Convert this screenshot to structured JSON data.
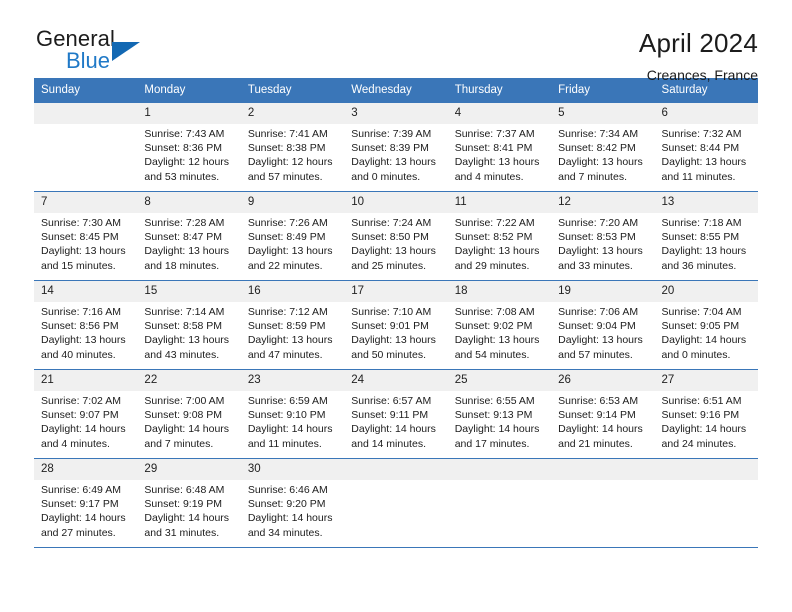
{
  "brand": {
    "name_top": "General",
    "name_bottom": "Blue",
    "accent_color": "#1268b3",
    "text_color": "#1c1c1c"
  },
  "header": {
    "title": "April 2024",
    "subtitle": "Creances, France"
  },
  "theme": {
    "header_row_bg": "#3a76b8",
    "header_row_text": "#ffffff",
    "daynum_bg": "#f0f0f0",
    "row_border": "#3a76b8"
  },
  "weekday_headers": [
    "Sunday",
    "Monday",
    "Tuesday",
    "Wednesday",
    "Thursday",
    "Friday",
    "Saturday"
  ],
  "labels": {
    "sunrise_prefix": "Sunrise:",
    "sunset_prefix": "Sunset:",
    "daylight_prefix": "Daylight:"
  },
  "weeks": [
    [
      {
        "day": "",
        "sunrise": "",
        "sunset": "",
        "daylight": ""
      },
      {
        "day": "1",
        "sunrise": "Sunrise: 7:43 AM",
        "sunset": "Sunset: 8:36 PM",
        "daylight": "Daylight: 12 hours and 53 minutes."
      },
      {
        "day": "2",
        "sunrise": "Sunrise: 7:41 AM",
        "sunset": "Sunset: 8:38 PM",
        "daylight": "Daylight: 12 hours and 57 minutes."
      },
      {
        "day": "3",
        "sunrise": "Sunrise: 7:39 AM",
        "sunset": "Sunset: 8:39 PM",
        "daylight": "Daylight: 13 hours and 0 minutes."
      },
      {
        "day": "4",
        "sunrise": "Sunrise: 7:37 AM",
        "sunset": "Sunset: 8:41 PM",
        "daylight": "Daylight: 13 hours and 4 minutes."
      },
      {
        "day": "5",
        "sunrise": "Sunrise: 7:34 AM",
        "sunset": "Sunset: 8:42 PM",
        "daylight": "Daylight: 13 hours and 7 minutes."
      },
      {
        "day": "6",
        "sunrise": "Sunrise: 7:32 AM",
        "sunset": "Sunset: 8:44 PM",
        "daylight": "Daylight: 13 hours and 11 minutes."
      }
    ],
    [
      {
        "day": "7",
        "sunrise": "Sunrise: 7:30 AM",
        "sunset": "Sunset: 8:45 PM",
        "daylight": "Daylight: 13 hours and 15 minutes."
      },
      {
        "day": "8",
        "sunrise": "Sunrise: 7:28 AM",
        "sunset": "Sunset: 8:47 PM",
        "daylight": "Daylight: 13 hours and 18 minutes."
      },
      {
        "day": "9",
        "sunrise": "Sunrise: 7:26 AM",
        "sunset": "Sunset: 8:49 PM",
        "daylight": "Daylight: 13 hours and 22 minutes."
      },
      {
        "day": "10",
        "sunrise": "Sunrise: 7:24 AM",
        "sunset": "Sunset: 8:50 PM",
        "daylight": "Daylight: 13 hours and 25 minutes."
      },
      {
        "day": "11",
        "sunrise": "Sunrise: 7:22 AM",
        "sunset": "Sunset: 8:52 PM",
        "daylight": "Daylight: 13 hours and 29 minutes."
      },
      {
        "day": "12",
        "sunrise": "Sunrise: 7:20 AM",
        "sunset": "Sunset: 8:53 PM",
        "daylight": "Daylight: 13 hours and 33 minutes."
      },
      {
        "day": "13",
        "sunrise": "Sunrise: 7:18 AM",
        "sunset": "Sunset: 8:55 PM",
        "daylight": "Daylight: 13 hours and 36 minutes."
      }
    ],
    [
      {
        "day": "14",
        "sunrise": "Sunrise: 7:16 AM",
        "sunset": "Sunset: 8:56 PM",
        "daylight": "Daylight: 13 hours and 40 minutes."
      },
      {
        "day": "15",
        "sunrise": "Sunrise: 7:14 AM",
        "sunset": "Sunset: 8:58 PM",
        "daylight": "Daylight: 13 hours and 43 minutes."
      },
      {
        "day": "16",
        "sunrise": "Sunrise: 7:12 AM",
        "sunset": "Sunset: 8:59 PM",
        "daylight": "Daylight: 13 hours and 47 minutes."
      },
      {
        "day": "17",
        "sunrise": "Sunrise: 7:10 AM",
        "sunset": "Sunset: 9:01 PM",
        "daylight": "Daylight: 13 hours and 50 minutes."
      },
      {
        "day": "18",
        "sunrise": "Sunrise: 7:08 AM",
        "sunset": "Sunset: 9:02 PM",
        "daylight": "Daylight: 13 hours and 54 minutes."
      },
      {
        "day": "19",
        "sunrise": "Sunrise: 7:06 AM",
        "sunset": "Sunset: 9:04 PM",
        "daylight": "Daylight: 13 hours and 57 minutes."
      },
      {
        "day": "20",
        "sunrise": "Sunrise: 7:04 AM",
        "sunset": "Sunset: 9:05 PM",
        "daylight": "Daylight: 14 hours and 0 minutes."
      }
    ],
    [
      {
        "day": "21",
        "sunrise": "Sunrise: 7:02 AM",
        "sunset": "Sunset: 9:07 PM",
        "daylight": "Daylight: 14 hours and 4 minutes."
      },
      {
        "day": "22",
        "sunrise": "Sunrise: 7:00 AM",
        "sunset": "Sunset: 9:08 PM",
        "daylight": "Daylight: 14 hours and 7 minutes."
      },
      {
        "day": "23",
        "sunrise": "Sunrise: 6:59 AM",
        "sunset": "Sunset: 9:10 PM",
        "daylight": "Daylight: 14 hours and 11 minutes."
      },
      {
        "day": "24",
        "sunrise": "Sunrise: 6:57 AM",
        "sunset": "Sunset: 9:11 PM",
        "daylight": "Daylight: 14 hours and 14 minutes."
      },
      {
        "day": "25",
        "sunrise": "Sunrise: 6:55 AM",
        "sunset": "Sunset: 9:13 PM",
        "daylight": "Daylight: 14 hours and 17 minutes."
      },
      {
        "day": "26",
        "sunrise": "Sunrise: 6:53 AM",
        "sunset": "Sunset: 9:14 PM",
        "daylight": "Daylight: 14 hours and 21 minutes."
      },
      {
        "day": "27",
        "sunrise": "Sunrise: 6:51 AM",
        "sunset": "Sunset: 9:16 PM",
        "daylight": "Daylight: 14 hours and 24 minutes."
      }
    ],
    [
      {
        "day": "28",
        "sunrise": "Sunrise: 6:49 AM",
        "sunset": "Sunset: 9:17 PM",
        "daylight": "Daylight: 14 hours and 27 minutes."
      },
      {
        "day": "29",
        "sunrise": "Sunrise: 6:48 AM",
        "sunset": "Sunset: 9:19 PM",
        "daylight": "Daylight: 14 hours and 31 minutes."
      },
      {
        "day": "30",
        "sunrise": "Sunrise: 6:46 AM",
        "sunset": "Sunset: 9:20 PM",
        "daylight": "Daylight: 14 hours and 34 minutes."
      },
      {
        "day": "",
        "sunrise": "",
        "sunset": "",
        "daylight": ""
      },
      {
        "day": "",
        "sunrise": "",
        "sunset": "",
        "daylight": ""
      },
      {
        "day": "",
        "sunrise": "",
        "sunset": "",
        "daylight": ""
      },
      {
        "day": "",
        "sunrise": "",
        "sunset": "",
        "daylight": ""
      }
    ]
  ]
}
